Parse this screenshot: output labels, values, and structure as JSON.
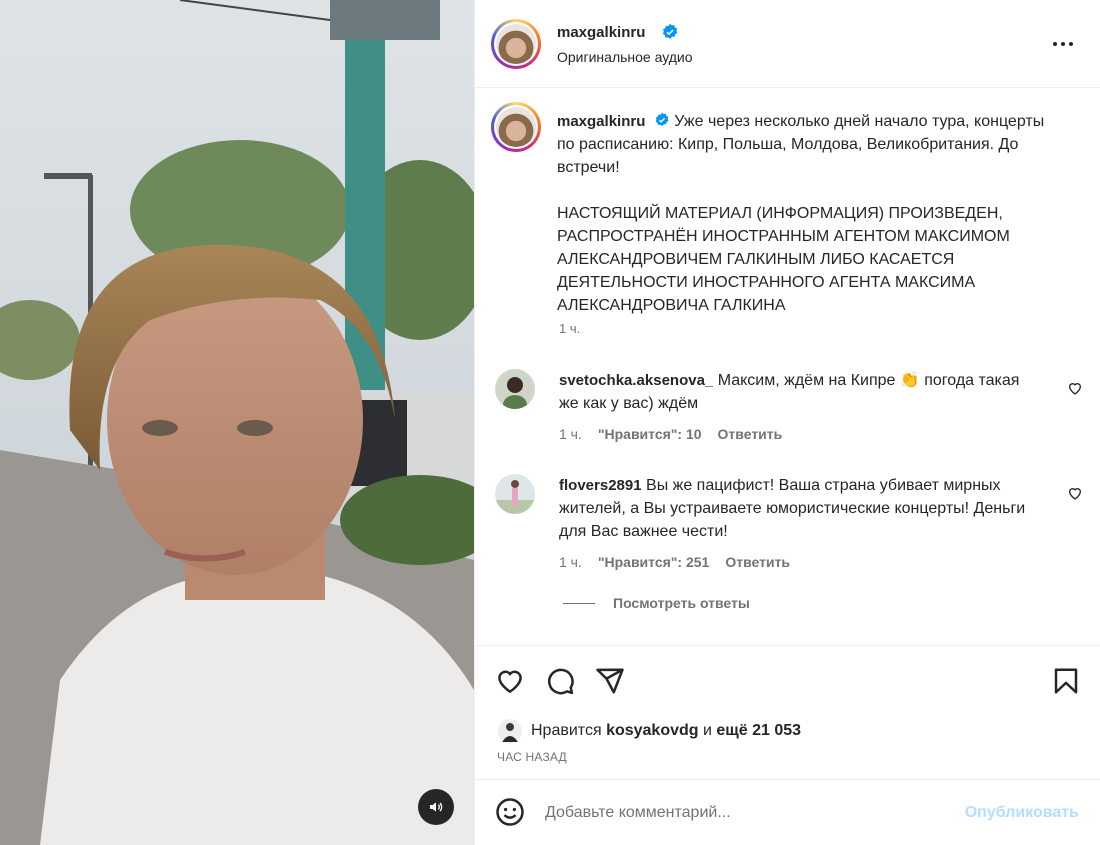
{
  "header": {
    "username": "maxgalkinru",
    "subtitle": "Оригинальное аудио"
  },
  "caption": {
    "username": "maxgalkinru",
    "text": "Уже через несколько дней начало тура, концерты по расписанию: Кипр, Польша, Молдова, Великобритания. До встречи!",
    "notice": "НАСТОЯЩИЙ МАТЕРИАЛ (ИНФОРМАЦИЯ) ПРОИЗВЕДЕН, РАСПРОСТРАНЁН ИНОСТРАННЫМ АГЕНТОМ МАКСИМОМ АЛЕКСАНДРОВИЧЕМ ГАЛКИНЫМ ЛИБО КАСАЕТСЯ ДЕЯТЕЛЬНОСТИ ИНОСТРАННОГО АГЕНТА МАКСИМА АЛЕКСАНДРОВИЧА ГАЛКИНА",
    "time": "1 ч."
  },
  "comments": [
    {
      "username": "svetochka.aksenova_",
      "text": "Максим, ждём на Кипре 👏 погода такая же как у вас) ждём",
      "time": "1 ч.",
      "likes": "\"Нравится\": 10",
      "reply": "Ответить"
    },
    {
      "username": "flovers2891",
      "text": "Вы же пацифист! Ваша страна убивает мирных жителей, а Вы устраиваете юмористические концерты! Деньги для Вас важнее чести!",
      "time": "1 ч.",
      "likes": "\"Нравится\": 251",
      "reply": "Ответить"
    }
  ],
  "view_replies": "Посмотреть ответы",
  "likes": {
    "prefix": "Нравится",
    "user": "kosyakovdg",
    "middle": "и",
    "rest": "ещё 21 053"
  },
  "posted_ago": "ЧАС НАЗАД",
  "add_comment": {
    "placeholder": "Добавьте комментарий...",
    "publish_label": "Опубликовать"
  },
  "colors": {
    "verified": "#0095f6",
    "publish_disabled": "#b2dffc",
    "secondary_text": "#737373"
  },
  "icons": [
    "verified-badge-icon",
    "more-options-icon",
    "heart-icon",
    "comment-icon",
    "share-icon",
    "bookmark-icon",
    "emoji-icon",
    "speaker-icon"
  ]
}
